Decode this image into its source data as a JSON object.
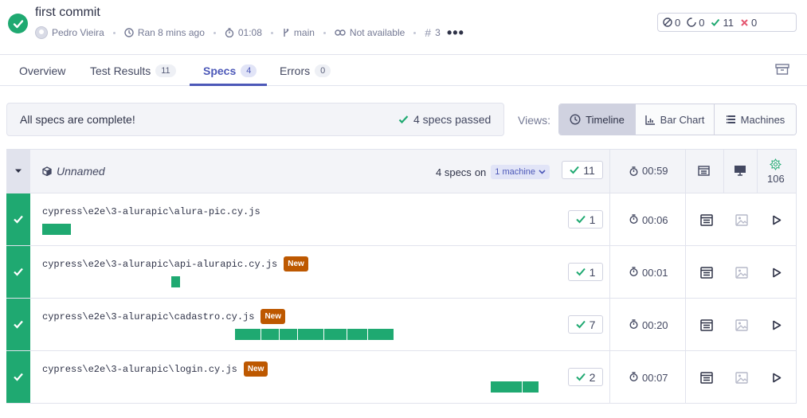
{
  "header": {
    "title": "first commit",
    "author": "Pedro Vieira",
    "ran": "Ran 8 mins ago",
    "duration": "01:08",
    "branch": "main",
    "pr": "Not available",
    "run_number": "3",
    "more": "•••"
  },
  "summary": {
    "skipped": "0",
    "pending": "0",
    "passed": "11",
    "failed": "0"
  },
  "tabs": [
    {
      "label": "Overview",
      "count": ""
    },
    {
      "label": "Test Results",
      "count": "11"
    },
    {
      "label": "Specs",
      "count": "4"
    },
    {
      "label": "Errors",
      "count": "0"
    }
  ],
  "banner": {
    "message": "All specs are complete!",
    "passed": "4 specs passed"
  },
  "views": {
    "label": "Views:",
    "options": [
      "Timeline",
      "Bar Chart",
      "Machines"
    ],
    "selected": "Timeline"
  },
  "group": {
    "name": "Unnamed",
    "specs_count": "4 specs",
    "on": "on",
    "machines": "1 machine",
    "passed": "11",
    "duration": "00:59",
    "flake_count": "106"
  },
  "specs": [
    {
      "path": "cypress\\e2e\\3-alurapic\\alura-pic.cy.js",
      "new": "",
      "passed": "1",
      "duration": "00:06"
    },
    {
      "path": "cypress\\e2e\\3-alurapic\\api-alurapic.cy.js",
      "new": "New",
      "passed": "1",
      "duration": "00:01"
    },
    {
      "path": "cypress\\e2e\\3-alurapic\\cadastro.cy.js",
      "new": "New",
      "passed": "7",
      "duration": "00:20"
    },
    {
      "path": "cypress\\e2e\\3-alurapic\\login.cy.js",
      "new": "New",
      "passed": "2",
      "duration": "00:07"
    }
  ],
  "colors": {
    "pass": "#1fa971",
    "accent": "#4c58b8",
    "new_badge": "#bd5800",
    "fail": "#e45770"
  }
}
